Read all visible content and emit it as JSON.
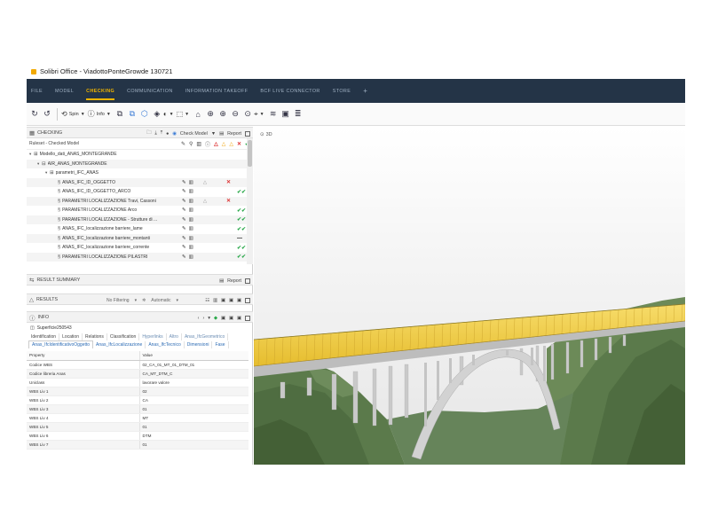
{
  "window": {
    "title": "Solibri Office - ViadottoPonteGrowde 130721"
  },
  "menu": {
    "items": [
      "FILE",
      "MODEL",
      "CHECKING",
      "COMMUNICATION",
      "INFORMATION TAKEOFF",
      "BCF LIVE CONNECTOR",
      "STORE"
    ],
    "active_index": 2,
    "plus": "+"
  },
  "toolbar": {
    "spin_label": "Spin",
    "info_label": "Info"
  },
  "checking": {
    "title": "CHECKING",
    "check_model_label": "Check Model",
    "report_label": "Report",
    "ruleset_label": "Ruleset - Checked Model",
    "rows": [
      {
        "label": "Modello_dati_ANAS_MONTEGRANDE",
        "indent": 0,
        "twisty": "▾",
        "icon": "⊞"
      },
      {
        "label": "AIR_ANAS_MONTEGRANDE",
        "indent": 1,
        "twisty": "▾",
        "icon": "⊟"
      },
      {
        "label": "parametri_IFC_ANAS",
        "indent": 2,
        "twisty": "▾",
        "icon": "⊞"
      },
      {
        "label": "ANAS_IFC_ID_OGGETTO",
        "indent": 3,
        "twisty": "",
        "icon": "§",
        "status": "tri",
        "result": "✕",
        "result_class": "c-red"
      },
      {
        "label": "ANAS_IFC_ID_OGGETTO_ARCO",
        "indent": 3,
        "twisty": "",
        "icon": "§",
        "status": "",
        "result": "✔✔",
        "result_class": "c-green"
      },
      {
        "label": "PARAMETRI LOCALIZZAZIONE Travi, Cassoni",
        "indent": 3,
        "twisty": "",
        "icon": "§",
        "status": "tri",
        "result": "✕",
        "result_class": "c-red"
      },
      {
        "label": "PARAMETRI LOCALIZZAZIONE Arco",
        "indent": 3,
        "twisty": "",
        "icon": "§",
        "status": "",
        "result": "✔✔",
        "result_class": "c-green"
      },
      {
        "label": "PARAMETRI LOCALIZZAZIONE - Strutture di ...",
        "indent": 3,
        "twisty": "",
        "icon": "§",
        "status": "",
        "result": "✔✔",
        "result_class": "c-green"
      },
      {
        "label": "ANAS_IFC_localizzazione barriere_lame",
        "indent": 3,
        "twisty": "",
        "icon": "§",
        "status": "",
        "result": "✔✔",
        "result_class": "c-green"
      },
      {
        "label": "ANAS_IFC_localizzazione barriere_montanti",
        "indent": 3,
        "twisty": "",
        "icon": "§",
        "status": "",
        "result": "—",
        "result_class": "c-black"
      },
      {
        "label": "ANAS_IFC_localizzazione barriere_corrente",
        "indent": 3,
        "twisty": "",
        "icon": "§",
        "status": "",
        "result": "✔✔",
        "result_class": "c-green"
      },
      {
        "label": "PARAMETRI LOCALIZZAZIONE PILASTRI",
        "indent": 3,
        "twisty": "",
        "icon": "§",
        "status": "",
        "result": "✔✔",
        "result_class": "c-green"
      }
    ]
  },
  "summary": {
    "title": "RESULT SUMMARY",
    "report_label": "Report"
  },
  "results": {
    "title": "RESULTS",
    "filter_label": "No Filtering",
    "auto_label": "Automatic"
  },
  "info": {
    "title": "INFO",
    "object_name": "Superficie250543",
    "tabs_row1": [
      "Identification",
      "Location",
      "Relations",
      "Classification",
      "Hyperlinks",
      "Altro",
      "Anas_IfcGeometrico"
    ],
    "tabs_row2": [
      "Anas_IfcIdentificativoOggetto",
      "Anas_IfcLocalizzazione",
      "Anas_IfcTecnico",
      "Dimensioni",
      "Fase"
    ],
    "table_headers": [
      "Property",
      "Value"
    ],
    "properties": [
      [
        "Codice WBS",
        "02_CA_01_MT_01_DTM_01"
      ],
      [
        "Codice libreria Anas",
        "CA_MT_DTM_C"
      ],
      [
        "Uniclass",
        "lavorare valore"
      ],
      [
        "WBS Liv 1",
        "02"
      ],
      [
        "WBS Liv 2",
        "CA"
      ],
      [
        "WBS Liv 3",
        "01"
      ],
      [
        "WBS Liv 4",
        "MT"
      ],
      [
        "WBS Liv 5",
        "01"
      ],
      [
        "WBS Liv 6",
        "DTM"
      ],
      [
        "WBS Liv 7",
        "01"
      ]
    ]
  },
  "view3d": {
    "label": "3D"
  },
  "colors": {
    "menubar_bg": "#243447",
    "accent": "#f0b400",
    "terrain": "#5b7a4b",
    "deck": "#f3d04a",
    "concrete": "#cfcfcf"
  }
}
